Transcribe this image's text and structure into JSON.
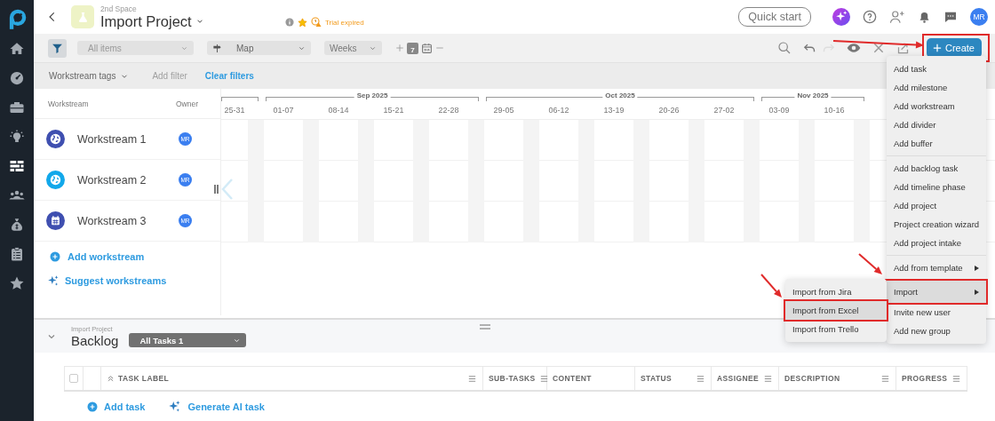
{
  "sidebar": {
    "items": [
      {
        "kind": "logo",
        "selected": false
      },
      {
        "kind": "home",
        "selected": false
      },
      {
        "kind": "dashboard",
        "selected": false
      },
      {
        "kind": "briefcase",
        "selected": false
      },
      {
        "kind": "bulb",
        "selected": false
      },
      {
        "kind": "gantt",
        "selected": true
      },
      {
        "kind": "team",
        "selected": false
      },
      {
        "kind": "money",
        "selected": false
      },
      {
        "kind": "clipboard",
        "selected": false
      },
      {
        "kind": "star",
        "selected": false
      }
    ]
  },
  "header": {
    "space": "2nd Space",
    "title": "Import Project",
    "favorite": true,
    "trial": "Trial expired",
    "quick_start": "Quick start",
    "avatar": "MR"
  },
  "toolbar": {
    "items_filter": {
      "placeholder": "All items",
      "disabled": true
    },
    "view": "Map",
    "scale": "Weeks",
    "today": "7",
    "create": {
      "label": "Create",
      "highlighted": true
    }
  },
  "filters": {
    "tags": "Workstream tags",
    "add_filter": {
      "label": "Add filter",
      "disabled": true
    },
    "clear": "Clear filters"
  },
  "workstreams": {
    "columns": [
      "Workstream",
      "Owner"
    ],
    "rows": [
      {
        "name": "Workstream 1",
        "kind": "globe",
        "color": "#3f4fb0",
        "owner": "MR"
      },
      {
        "name": "Workstream 2",
        "kind": "globe",
        "color": "#12a8ea",
        "owner": "MR"
      },
      {
        "name": "Workstream 3",
        "kind": "calendar",
        "color": "#3f4fb0",
        "owner": "MR"
      }
    ],
    "add": "Add workstream",
    "suggest": "Suggest workstreams"
  },
  "timeline": {
    "lead_weeks": [
      "25-31"
    ],
    "months": [
      {
        "label": "Sep 2025",
        "weeks": [
          "01-07",
          "08-14",
          "15-21",
          "22-28"
        ]
      },
      {
        "label": "Oct 2025",
        "weeks": [
          "29-05",
          "06-12",
          "13-19",
          "20-26",
          "27-02"
        ]
      },
      {
        "label": "Nov 2025",
        "weeks": [
          "03-09",
          "10-16"
        ]
      }
    ]
  },
  "create_menu": {
    "sections": [
      [
        {
          "label": "Add task",
          "submenu": false,
          "selected": false,
          "highlighted": false
        },
        {
          "label": "Add milestone",
          "submenu": false,
          "selected": false,
          "highlighted": false
        },
        {
          "label": "Add workstream",
          "submenu": false,
          "selected": false,
          "highlighted": false
        },
        {
          "label": "Add divider",
          "submenu": false,
          "selected": false,
          "highlighted": false
        },
        {
          "label": "Add buffer",
          "submenu": false,
          "selected": false,
          "highlighted": false
        }
      ],
      [
        {
          "label": "Add backlog task",
          "submenu": false,
          "selected": false,
          "highlighted": false
        },
        {
          "label": "Add timeline phase",
          "submenu": false,
          "selected": false,
          "highlighted": false
        },
        {
          "label": "Add project",
          "submenu": false,
          "selected": false,
          "highlighted": false
        },
        {
          "label": "Project creation wizard",
          "submenu": false,
          "selected": false,
          "highlighted": false
        },
        {
          "label": "Add project intake",
          "submenu": false,
          "selected": false,
          "highlighted": false
        }
      ],
      [
        {
          "label": "Add from template",
          "submenu": true,
          "selected": false,
          "highlighted": false
        },
        {
          "label": "Import",
          "submenu": true,
          "selected": true,
          "highlighted": true
        },
        {
          "label": "Invite new user",
          "submenu": false,
          "selected": false,
          "highlighted": false
        },
        {
          "label": "Add new group",
          "submenu": false,
          "selected": false,
          "highlighted": false
        }
      ]
    ]
  },
  "import_menu": {
    "items": [
      {
        "label": "Import from Jira",
        "selected": false,
        "highlighted": false
      },
      {
        "label": "Import from Excel",
        "selected": true,
        "highlighted": true
      },
      {
        "label": "Import from Trello",
        "selected": false,
        "highlighted": false
      }
    ]
  },
  "backlog": {
    "project": "Import Project",
    "title": "Backlog",
    "filter": "All Tasks 1",
    "select_all": {
      "checked": false
    },
    "columns": [
      {
        "label": "TASK LABEL",
        "sortable": true,
        "menu": true
      },
      {
        "label": "SUB-TASKS",
        "sortable": false,
        "menu": true
      },
      {
        "label": "CONTENT",
        "sortable": false,
        "menu": false
      },
      {
        "label": "STATUS",
        "sortable": false,
        "menu": true
      },
      {
        "label": "ASSIGNEE",
        "sortable": false,
        "menu": true
      },
      {
        "label": "DESCRIPTION",
        "sortable": false,
        "menu": true
      },
      {
        "label": "PROGRESS",
        "sortable": false,
        "menu": true
      }
    ],
    "add_task": "Add task",
    "generate": "Generate AI task"
  }
}
